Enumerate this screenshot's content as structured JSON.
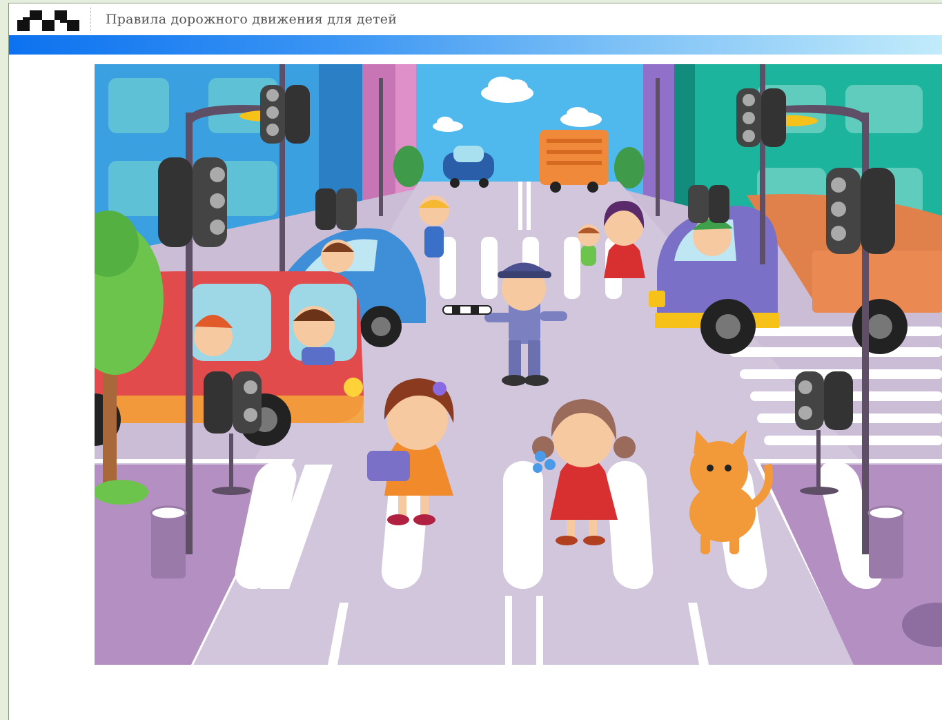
{
  "header": {
    "title": "Правила дорожного движения для детей",
    "logo_icon": "checkered-flag-icon"
  },
  "theme": {
    "band_start": "#0d72f0",
    "band_end": "#c2ebfb",
    "page_bg": "#e6efdc",
    "frame_bg": "#ffffff"
  },
  "illustration": {
    "icon": "crosswalk-scene-illustration"
  }
}
